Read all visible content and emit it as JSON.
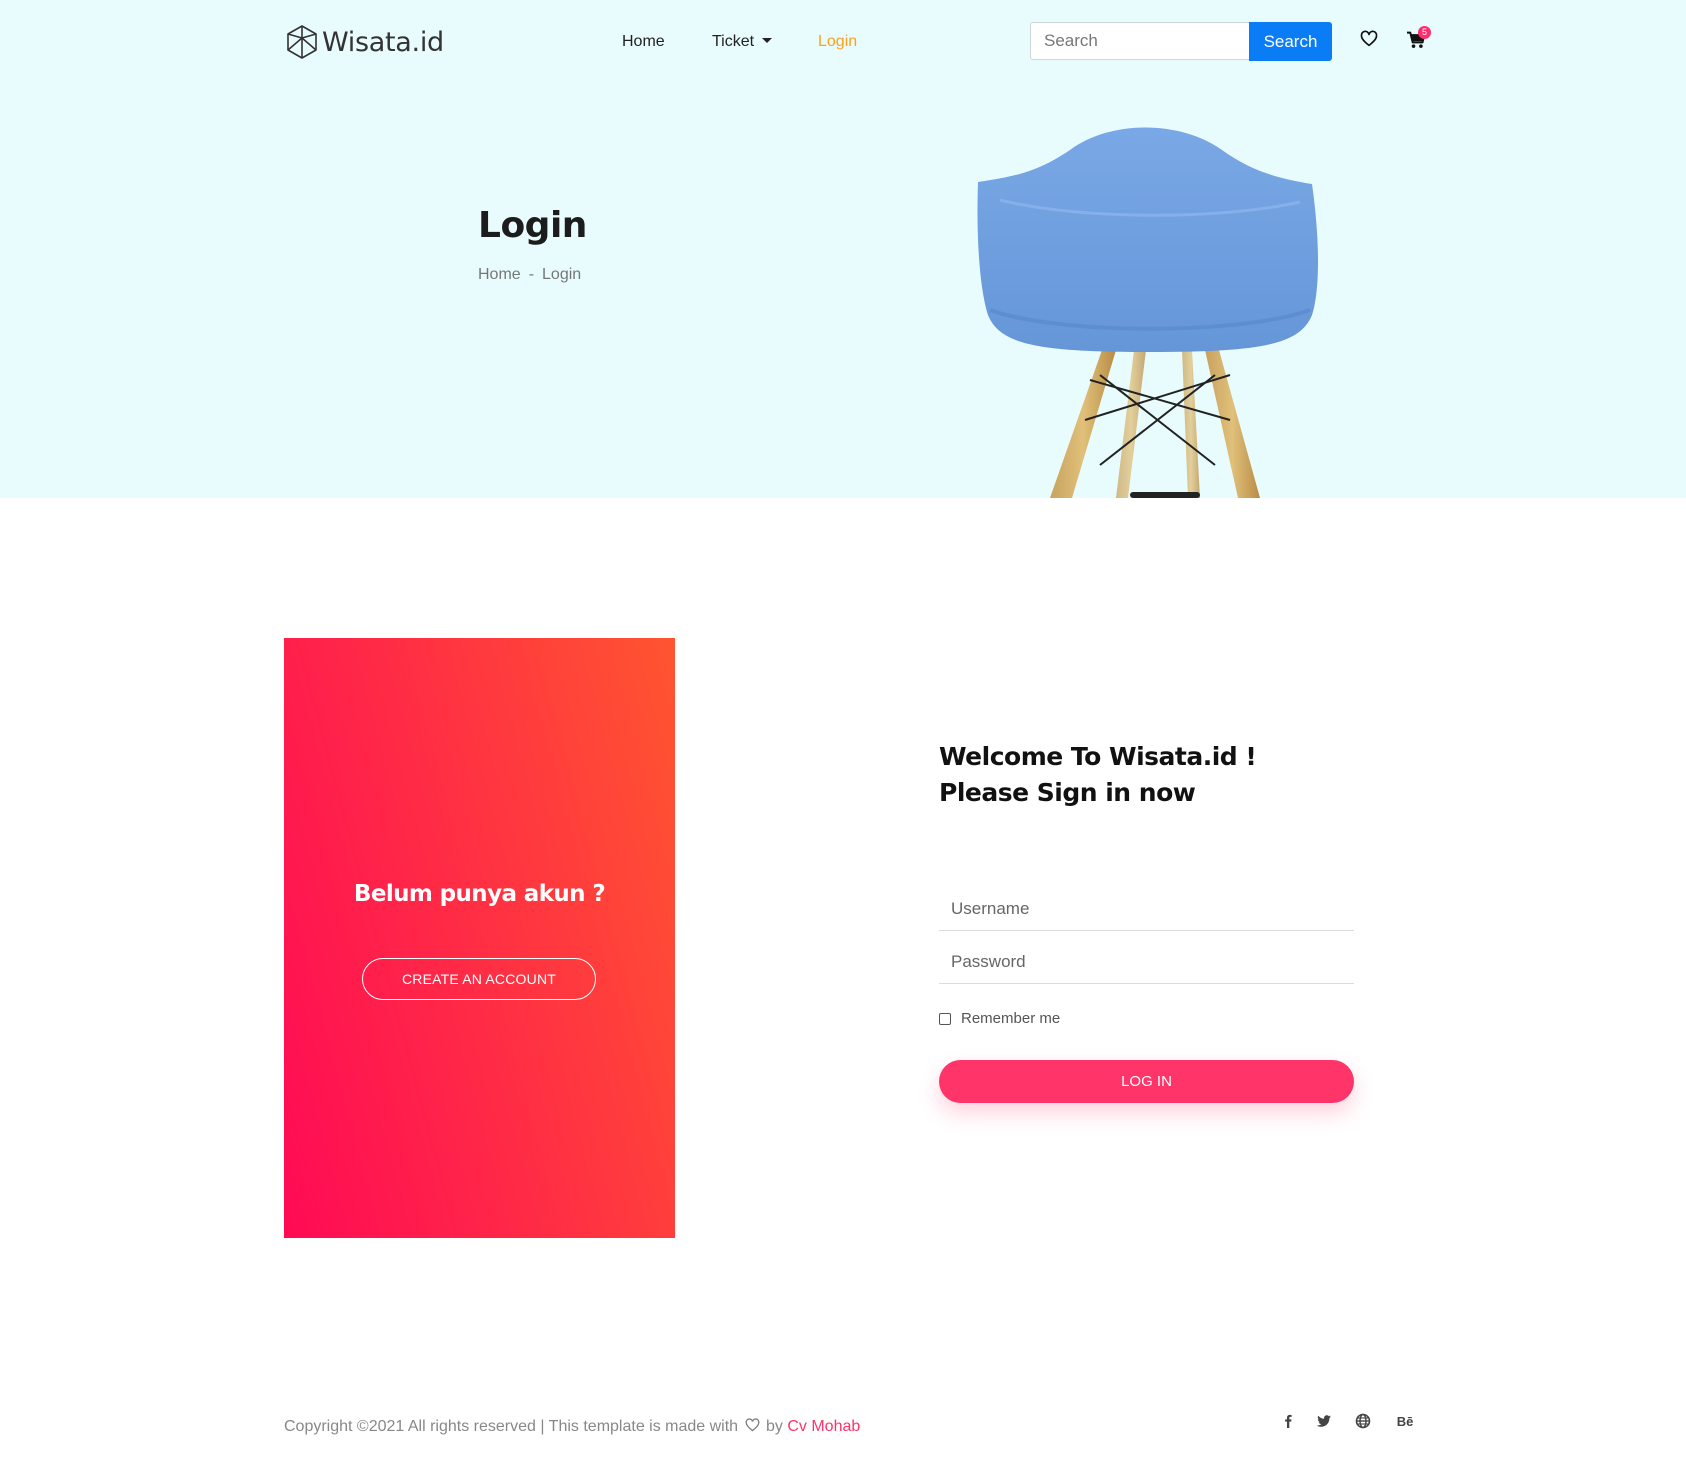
{
  "header": {
    "logo_text": "Wisata.id",
    "nav": {
      "home": "Home",
      "ticket": "Ticket",
      "login": "Login"
    },
    "search": {
      "placeholder": "Search",
      "button_label": "Search"
    },
    "cart_count": "5"
  },
  "hero": {
    "title": "Login",
    "breadcrumb": {
      "home": "Home",
      "separator": "-",
      "current": "Login"
    }
  },
  "promo": {
    "title": "Belum punya akun ?",
    "button_label": "CREATE AN ACCOUNT"
  },
  "login_form": {
    "welcome_line1": "Welcome To Wisata.id !",
    "welcome_line2": "Please Sign in now",
    "username_placeholder": "Username",
    "password_placeholder": "Password",
    "remember_label": "Remember me",
    "submit_label": "LOG IN"
  },
  "footer": {
    "copyright_prefix": "Copyright ©2021 All rights reserved | This template is made with",
    "copyright_by": "by",
    "author": "Cv Mohab",
    "behance_label": "Bē"
  },
  "colors": {
    "hero_bg": "#e8fcfd",
    "accent_orange": "#ff9f1a",
    "search_blue": "#0a7cf5",
    "brand_pink": "#ff3468"
  },
  "icons": [
    "logo-icon",
    "heart-icon",
    "cart-icon",
    "facebook-icon",
    "twitter-icon",
    "globe-icon",
    "behance-icon"
  ]
}
